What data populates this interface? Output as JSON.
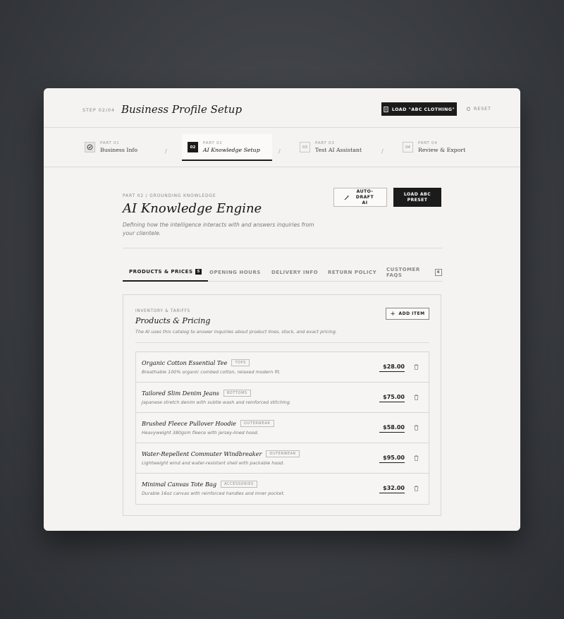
{
  "header": {
    "step_kicker": "STEP 02/04",
    "title": "Business Profile Setup",
    "load_label": "LOAD \"ABC CLOTHING\"",
    "reset_label": "RESET"
  },
  "stepper": [
    {
      "part": "PART 01",
      "name": "Business Info",
      "badge": ""
    },
    {
      "part": "PART 02",
      "name": "AI Knowledge Setup",
      "badge": "02"
    },
    {
      "part": "PART 03",
      "name": "Test AI Assistant",
      "badge": "03"
    },
    {
      "part": "PART 04",
      "name": "Review & Export",
      "badge": "04"
    }
  ],
  "section": {
    "kicker": "PART 02 / GROUNDING KNOWLEDGE",
    "title": "AI Knowledge Engine",
    "description": "Defining how the intelligence interacts with and answers inquiries from your clientele.",
    "auto_draft_label": "AUTO-DRAFT AI",
    "load_preset_label": "LOAD ABC PRESET"
  },
  "tabs": [
    {
      "label": "PRODUCTS & PRICES",
      "count": "5"
    },
    {
      "label": "OPENING HOURS",
      "count": ""
    },
    {
      "label": "DELIVERY INFO",
      "count": ""
    },
    {
      "label": "RETURN POLICY",
      "count": ""
    },
    {
      "label": "CUSTOMER FAQS",
      "count": "4"
    }
  ],
  "panel": {
    "kicker": "INVENTORY & TARIFFS",
    "title": "Products & Pricing",
    "description": "The AI uses this catalog to answer inquiries about product lines, stock, and exact pricing.",
    "add_label": "ADD ITEM"
  },
  "products": [
    {
      "name": "Organic Cotton Essential Tee",
      "category": "TOPS",
      "description": "Breathable 100% organic combed cotton, relaxed modern fit.",
      "price": "$28.00"
    },
    {
      "name": "Tailored Slim Denim Jeans",
      "category": "BOTTOMS",
      "description": "Japanese stretch denim with subtle wash and reinforced stitching.",
      "price": "$75.00"
    },
    {
      "name": "Brushed Fleece Pullover Hoodie",
      "category": "OUTERWEAR",
      "description": "Heavyweight 380gsm fleece with jersey-lined hood.",
      "price": "$58.00"
    },
    {
      "name": "Water-Repellent Commuter Windbreaker",
      "category": "OUTERWEAR",
      "description": "Lightweight wind and water-resistant shell with packable hood.",
      "price": "$95.00"
    },
    {
      "name": "Minimal Canvas Tote Bag",
      "category": "ACCESSORIES",
      "description": "Durable 16oz canvas with reinforced handles and inner pocket.",
      "price": "$32.00"
    }
  ]
}
